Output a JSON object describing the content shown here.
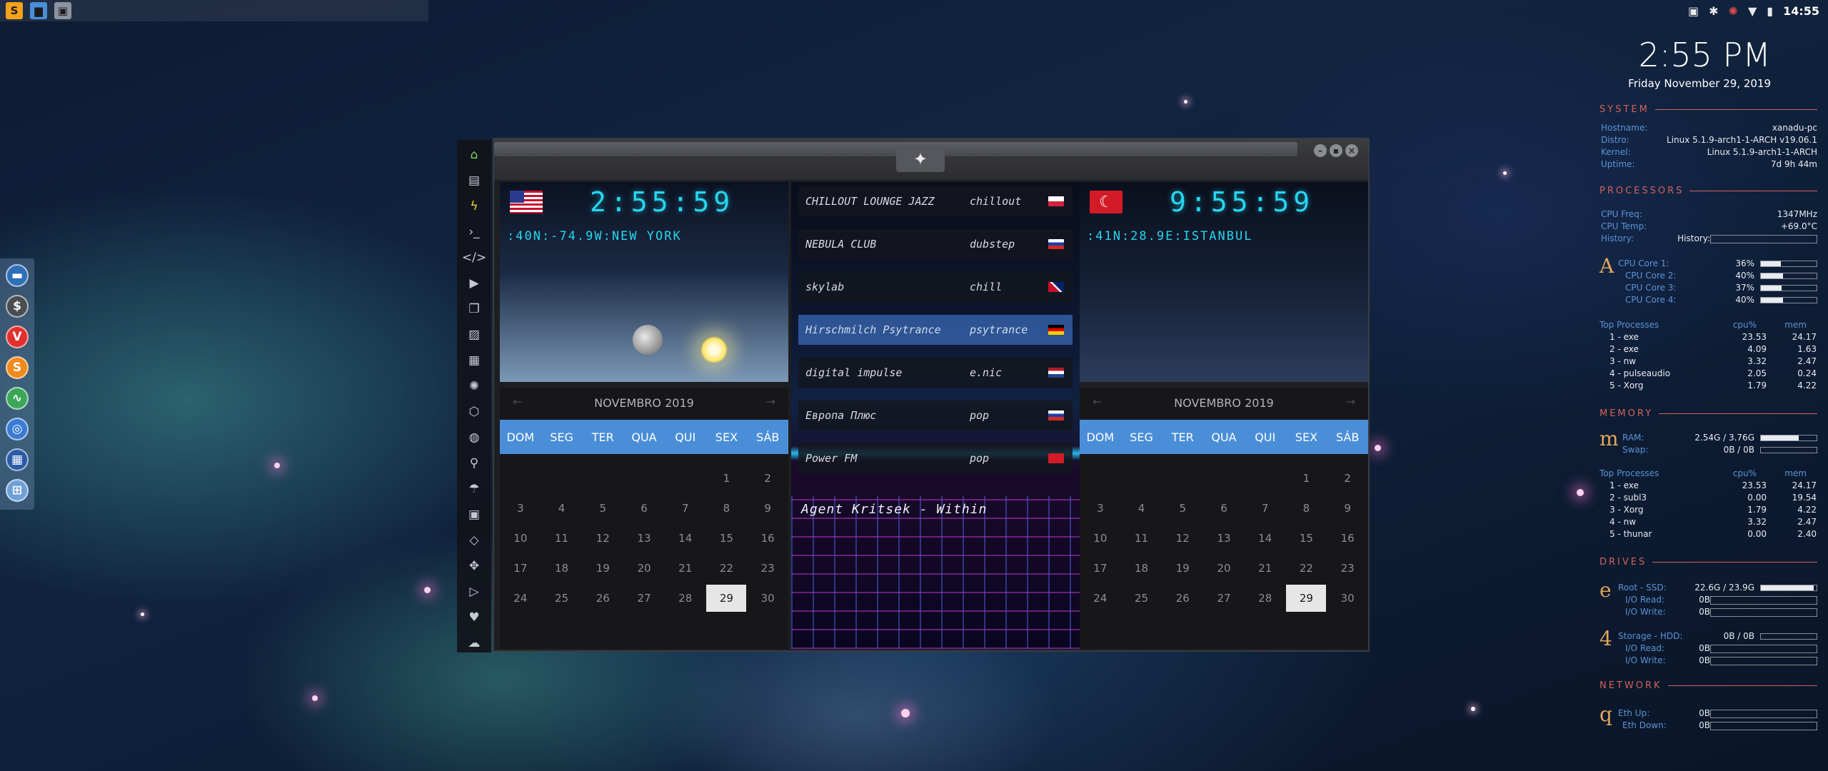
{
  "taskbar": {
    "clock": "14:55",
    "apps": [
      {
        "icon": "sublime-icon",
        "glyph": "S",
        "color": "#f6a21b"
      },
      {
        "icon": "files-icon",
        "glyph": "▆",
        "color": "#4a8ed8"
      },
      {
        "icon": "window-icon",
        "glyph": "▣",
        "color": "#8c93a0"
      }
    ]
  },
  "dock": {
    "apps": [
      {
        "name": "dock-app-screen-icon",
        "glyph": "▬",
        "color": "#2e6fb8"
      },
      {
        "name": "dock-app-money-icon",
        "glyph": "$",
        "color": "#4a4d52"
      },
      {
        "name": "dock-app-vivaldi-icon",
        "glyph": "V",
        "color": "#e0312e"
      },
      {
        "name": "dock-app-sublime-icon",
        "glyph": "S",
        "color": "#f08a1e"
      },
      {
        "name": "dock-app-monitor-icon",
        "glyph": "∿",
        "color": "#3ba657"
      },
      {
        "name": "dock-app-chrome-icon",
        "glyph": "◎",
        "color": "#3a7bd5"
      },
      {
        "name": "dock-app-desktop-icon",
        "glyph": "▦",
        "color": "#2a5aa8"
      },
      {
        "name": "dock-app-grid-icon",
        "glyph": "⊞",
        "color": "#6fa0d8"
      }
    ]
  },
  "sidebar": {
    "icons": [
      "home-icon",
      "document-icon",
      "flash-icon",
      "terminal-icon",
      "code-icon",
      "play-icon",
      "copy-icon",
      "image-icon",
      "news-icon",
      "settings-icon",
      "hexagon-icon",
      "globe-icon",
      "search-icon",
      "umbrella-icon",
      "contact-icon",
      "code-brackets-icon",
      "expand-icon",
      "youtube-icon",
      "heart-icon",
      "cloud-icon"
    ]
  },
  "clocks": {
    "left": {
      "time": "2:55:59",
      "location": ":40N:-74.9W:NEW YORK",
      "country": "us"
    },
    "right": {
      "time": "9:55:59",
      "location": ":41N:28.9E:ISTANBUL",
      "country": "tr"
    }
  },
  "calendar": {
    "month": "NOVEMBRO 2019",
    "days": [
      "DOM",
      "SEG",
      "TER",
      "QUA",
      "QUI",
      "SEX",
      "SÁB"
    ],
    "weeks": [
      [
        "",
        "",
        "",
        "",
        "",
        "1",
        "2"
      ],
      [
        "3",
        "4",
        "5",
        "6",
        "7",
        "8",
        "9"
      ],
      [
        "10",
        "11",
        "12",
        "13",
        "14",
        "15",
        "16"
      ],
      [
        "17",
        "18",
        "19",
        "20",
        "21",
        "22",
        "23"
      ],
      [
        "24",
        "25",
        "26",
        "27",
        "28",
        "29",
        "30"
      ]
    ],
    "today": "29"
  },
  "radio": {
    "stations": [
      {
        "name": "CHILLOUT LOUNGE JAZZ",
        "genre": "chillout",
        "flag": "pl"
      },
      {
        "name": "NEBULA CLUB",
        "genre": "dubstep",
        "flag": "ru"
      },
      {
        "name": "skylab",
        "genre": "chill",
        "flag": "gb"
      },
      {
        "name": "Hirschmilch Psytrance",
        "genre": "psytrance",
        "flag": "de"
      },
      {
        "name": "digital impulse",
        "genre": "e.nic",
        "flag": "nl"
      },
      {
        "name": "Европа Плюс",
        "genre": "pop",
        "flag": "ru"
      },
      {
        "name": "Power FM",
        "genre": "pop",
        "flag": "tr"
      }
    ],
    "selected": 3,
    "now_playing": "Agent Kritsek - Within"
  },
  "conky": {
    "time": "2:55 PM",
    "date": "Friday November 29, 2019",
    "system": {
      "title": "SYSTEM",
      "rows": [
        {
          "label": "Hostname:",
          "value": "xanadu-pc"
        },
        {
          "label": "Distro:",
          "value": "Linux 5.1.9-arch1-1-ARCH v19.06.1"
        },
        {
          "label": "Kernel:",
          "value": "Linux 5.1.9-arch1-1-ARCH"
        },
        {
          "label": "Uptime:",
          "value": "7d 9h 44m"
        }
      ]
    },
    "processors": {
      "title": "PROCESSORS",
      "freq_label": "CPU Freq:",
      "freq": "1347MHz",
      "temp_label": "CPU Temp:",
      "temp": "+69.0°C",
      "history_label": "History:",
      "glyph": "A",
      "cores": [
        {
          "label": "CPU Core 1:",
          "value": "36%",
          "level": 0.36
        },
        {
          "label": "CPU Core 2:",
          "value": "40%",
          "level": 0.4
        },
        {
          "label": "CPU Core 3:",
          "value": "37%",
          "level": 0.37
        },
        {
          "label": "CPU Core 4:",
          "value": "40%",
          "level": 0.4
        }
      ],
      "proc_header": [
        "Top Processes",
        "cpu%",
        "mem"
      ],
      "procs": [
        [
          "1 - exe",
          "23.53",
          "24.17"
        ],
        [
          "2 - exe",
          "4.09",
          "1.63"
        ],
        [
          "3 - nw",
          "3.32",
          "2.47"
        ],
        [
          "4 - pulseaudio",
          "2.05",
          "0.24"
        ],
        [
          "5 - Xorg",
          "1.79",
          "4.22"
        ]
      ]
    },
    "memory": {
      "title": "MEMORY",
      "glyph": "m",
      "ram_label": "RAM:",
      "ram": "2.54G / 3.76G",
      "ram_level": 0.68,
      "swap_label": "Swap:",
      "swap": "0B / 0B",
      "proc_header": [
        "Top Processes",
        "cpu%",
        "mem"
      ],
      "procs": [
        [
          "1 - exe",
          "23.53",
          "24.17"
        ],
        [
          "2 - subl3",
          "0.00",
          "19.54"
        ],
        [
          "3 - Xorg",
          "1.79",
          "4.22"
        ],
        [
          "4 - nw",
          "3.32",
          "2.47"
        ],
        [
          "5 - thunar",
          "0.00",
          "2.40"
        ]
      ]
    },
    "drives": {
      "title": "DRIVES",
      "root_glyph": "e",
      "root_label": "Root - SSD:",
      "root": "22.6G / 23.9G",
      "root_level": 0.95,
      "root_read_label": "I/O Read:",
      "root_read": "0B",
      "root_write_label": "I/O Write:",
      "root_write": "0B",
      "storage_glyph": "4",
      "storage_label": "Storage - HDD:",
      "storage": "0B / 0B",
      "storage_read_label": "I/O Read:",
      "storage_read": "0B",
      "storage_write_label": "I/O Write:",
      "storage_write": "0B"
    },
    "network": {
      "title": "NETWORK",
      "glyph": "q",
      "up_label": "Eth Up:",
      "up": "0B",
      "down_label": "Eth Down:",
      "down": "0B"
    }
  }
}
